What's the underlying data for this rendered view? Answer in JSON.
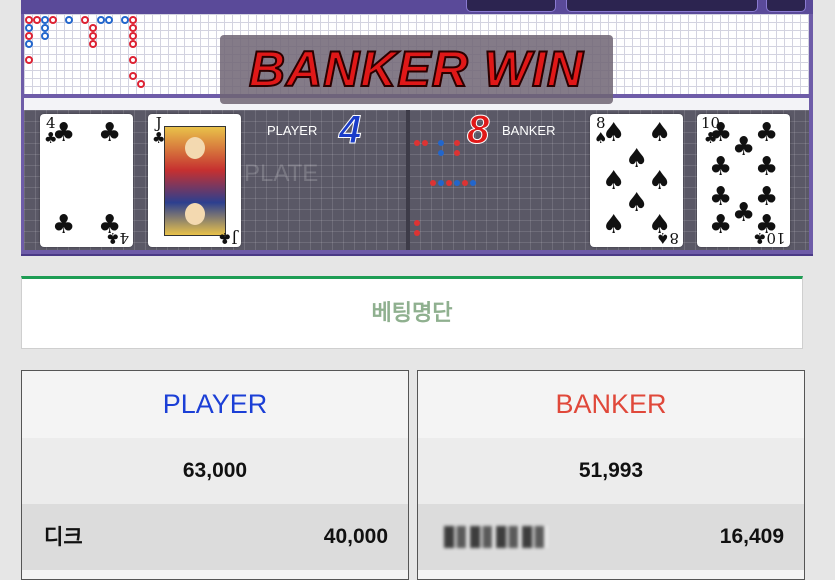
{
  "game": {
    "result_banner": "BANKER WIN",
    "plate_watermark": "PLATE",
    "player": {
      "label": "PLAYER",
      "score": "4"
    },
    "banker": {
      "label": "BANKER",
      "score": "8"
    },
    "player_cards": [
      {
        "rank": "4",
        "suit": "♣",
        "name": "4-of-clubs"
      },
      {
        "rank": "J",
        "suit": "♣",
        "name": "jack-of-clubs"
      }
    ],
    "banker_cards": [
      {
        "rank": "8",
        "suit": "♠",
        "name": "8-of-spades"
      },
      {
        "rank": "10",
        "suit": "♣",
        "name": "10-of-clubs"
      }
    ],
    "colors": {
      "player": "#1a3cc8",
      "banker": "#e01818",
      "frame": "#6e5ca8"
    }
  },
  "bet_list": {
    "title": "베팅명단",
    "accent": "#1e9d54",
    "player_column": {
      "header": "PLAYER",
      "header_color": "#1b3fd6",
      "total": "63,000",
      "entries": [
        {
          "name": "디크",
          "amount": "40,000"
        }
      ]
    },
    "banker_column": {
      "header": "BANKER",
      "header_color": "#e0483a",
      "total": "51,993",
      "entries": [
        {
          "name": "",
          "amount": "16,409"
        }
      ]
    }
  }
}
